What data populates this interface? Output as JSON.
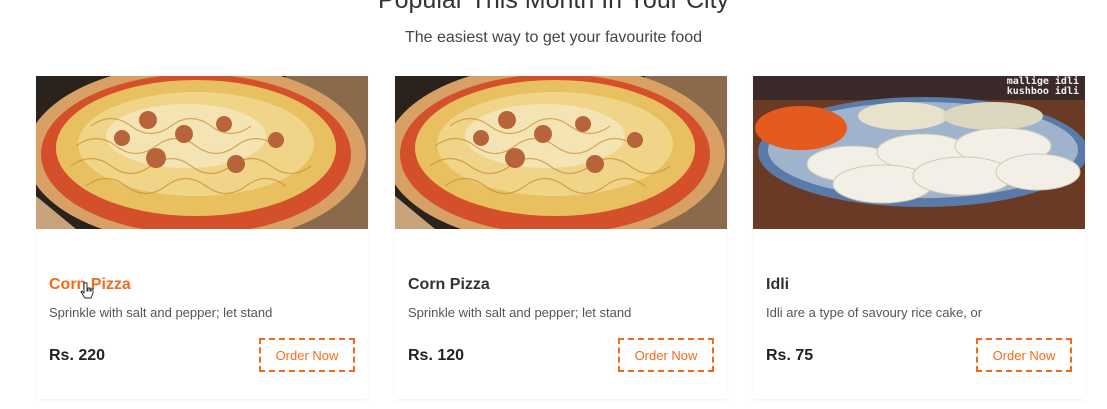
{
  "section": {
    "title": "Popular This Month In Your City",
    "subtitle": "The easiest way to get your favourite food"
  },
  "cards": [
    {
      "title": "Corn Pizza",
      "description": "Sprinkle with salt and pepper; let stand",
      "price": "Rs. 220",
      "button": "Order Now",
      "image": "pizza-photo",
      "hovered": true
    },
    {
      "title": "Corn Pizza",
      "description": "Sprinkle with salt and pepper; let stand",
      "price": "Rs. 120",
      "button": "Order Now",
      "image": "pizza-photo",
      "hovered": false
    },
    {
      "title": "Idli",
      "description": "Idli are a type of savoury rice cake, or",
      "price": "Rs. 75",
      "button": "Order Now",
      "image": "idli-photo",
      "image_caption": "mallige idli kushboo idli",
      "hovered": false
    }
  ],
  "colors": {
    "accent": "#f26b1d",
    "text": "#333333"
  }
}
